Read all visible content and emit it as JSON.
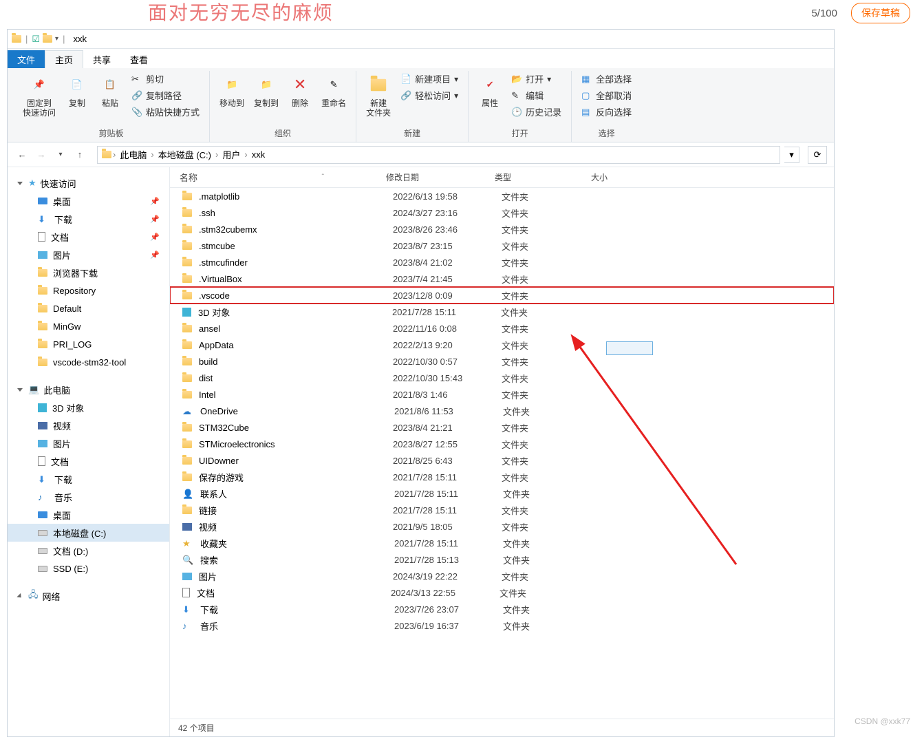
{
  "overlay": {
    "text": "面对无穷无尽的麻烦",
    "counter": "5/100",
    "save": "保存草稿"
  },
  "title": {
    "window": "xxk"
  },
  "tabs": {
    "file": "文件",
    "home": "主页",
    "share": "共享",
    "view": "查看"
  },
  "ribbon": {
    "pin": {
      "l1": "固定到",
      "l2": "快速访问"
    },
    "copy": "复制",
    "paste": "粘贴",
    "cut": "剪切",
    "copypath": "复制路径",
    "pasteshort": "粘贴快捷方式",
    "clipboard": "剪贴板",
    "moveto": "移动到",
    "copyto": "复制到",
    "delete": "删除",
    "rename": "重命名",
    "organize": "组织",
    "newfolder": {
      "l1": "新建",
      "l2": "文件夹"
    },
    "newitem": "新建项目",
    "easyaccess": "轻松访问",
    "new": "新建",
    "properties": "属性",
    "open": "打开",
    "edit": "编辑",
    "history": "历史记录",
    "opengrp": "打开",
    "selectall": "全部选择",
    "selectnone": "全部取消",
    "invertsel": "反向选择",
    "select": "选择"
  },
  "breadcrumb": {
    "pc": "此电脑",
    "drive": "本地磁盘 (C:)",
    "users": "用户",
    "folder": "xxk"
  },
  "columns": {
    "name": "名称",
    "date": "修改日期",
    "type": "类型",
    "size": "大小"
  },
  "sidebar": {
    "quick": "快速访问",
    "quick_items": [
      {
        "label": "桌面",
        "icon": "desktop",
        "pin": true
      },
      {
        "label": "下载",
        "icon": "dl",
        "pin": true
      },
      {
        "label": "文档",
        "icon": "doc",
        "pin": true
      },
      {
        "label": "图片",
        "icon": "pic",
        "pin": true
      },
      {
        "label": "浏览器下载",
        "icon": "folder",
        "pin": false
      },
      {
        "label": "Repository",
        "icon": "folder",
        "pin": false
      },
      {
        "label": "Default",
        "icon": "folder",
        "pin": false
      },
      {
        "label": "MinGw",
        "icon": "folder",
        "pin": false
      },
      {
        "label": "PRI_LOG",
        "icon": "folder",
        "pin": false
      },
      {
        "label": "vscode-stm32-tool",
        "icon": "folder",
        "pin": false
      }
    ],
    "pc": "此电脑",
    "pc_items": [
      {
        "label": "3D 对象",
        "icon": "3d"
      },
      {
        "label": "视频",
        "icon": "vid"
      },
      {
        "label": "图片",
        "icon": "pic"
      },
      {
        "label": "文档",
        "icon": "doc"
      },
      {
        "label": "下载",
        "icon": "dl"
      },
      {
        "label": "音乐",
        "icon": "mus"
      },
      {
        "label": "桌面",
        "icon": "desktop"
      },
      {
        "label": "本地磁盘 (C:)",
        "icon": "drive",
        "selected": true
      },
      {
        "label": "文档 (D:)",
        "icon": "drive"
      },
      {
        "label": "SSD (E:)",
        "icon": "drive"
      }
    ],
    "network": "网络"
  },
  "folder_type": "文件夹",
  "files": [
    {
      "name": ".matplotlib",
      "date": "2022/6/13 19:58",
      "icon": "folder"
    },
    {
      "name": ".ssh",
      "date": "2024/3/27 23:16",
      "icon": "folder"
    },
    {
      "name": ".stm32cubemx",
      "date": "2023/8/26 23:46",
      "icon": "folder"
    },
    {
      "name": ".stmcube",
      "date": "2023/8/7 23:15",
      "icon": "folder"
    },
    {
      "name": ".stmcufinder",
      "date": "2023/8/4 21:02",
      "icon": "folder"
    },
    {
      "name": ".VirtualBox",
      "date": "2023/7/4 21:45",
      "icon": "folder"
    },
    {
      "name": ".vscode",
      "date": "2023/12/8 0:09",
      "icon": "folder",
      "highlight": true
    },
    {
      "name": "3D 对象",
      "date": "2021/7/28 15:11",
      "icon": "3d"
    },
    {
      "name": "ansel",
      "date": "2022/11/16 0:08",
      "icon": "folder"
    },
    {
      "name": "AppData",
      "date": "2022/2/13 9:20",
      "icon": "folder"
    },
    {
      "name": "build",
      "date": "2022/10/30 0:57",
      "icon": "folder"
    },
    {
      "name": "dist",
      "date": "2022/10/30 15:43",
      "icon": "folder"
    },
    {
      "name": "Intel",
      "date": "2021/8/3 1:46",
      "icon": "folder"
    },
    {
      "name": "OneDrive",
      "date": "2021/8/6 11:53",
      "icon": "onedrive"
    },
    {
      "name": "STM32Cube",
      "date": "2023/8/4 21:21",
      "icon": "folder"
    },
    {
      "name": "STMicroelectronics",
      "date": "2023/8/27 12:55",
      "icon": "folder"
    },
    {
      "name": "UIDowner",
      "date": "2021/8/25 6:43",
      "icon": "folder"
    },
    {
      "name": "保存的游戏",
      "date": "2021/7/28 15:11",
      "icon": "folder"
    },
    {
      "name": "联系人",
      "date": "2021/7/28 15:11",
      "icon": "contacts"
    },
    {
      "name": "链接",
      "date": "2021/7/28 15:11",
      "icon": "folder"
    },
    {
      "name": "视频",
      "date": "2021/9/5 18:05",
      "icon": "vid"
    },
    {
      "name": "收藏夹",
      "date": "2021/7/28 15:11",
      "icon": "fav"
    },
    {
      "name": "搜索",
      "date": "2021/7/28 15:13",
      "icon": "search"
    },
    {
      "name": "图片",
      "date": "2024/3/19 22:22",
      "icon": "pic"
    },
    {
      "name": "文档",
      "date": "2024/3/13 22:55",
      "icon": "doc"
    },
    {
      "name": "下载",
      "date": "2023/7/26 23:07",
      "icon": "dl"
    },
    {
      "name": "音乐",
      "date": "2023/6/19 16:37",
      "icon": "mus"
    }
  ],
  "status": "42 个项目",
  "watermark": "CSDN @xxk77"
}
